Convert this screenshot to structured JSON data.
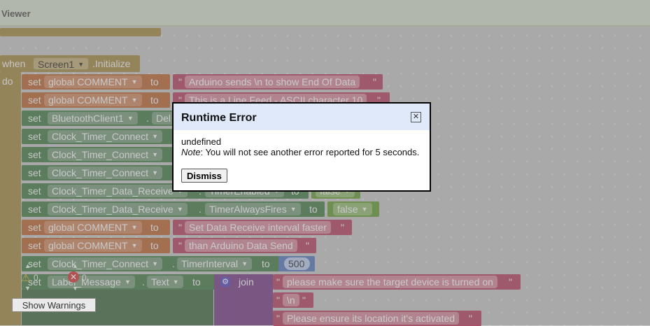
{
  "header": {
    "title": "Viewer"
  },
  "event": {
    "when": "when",
    "component": "Screen1",
    "event": ".Initialize",
    "do": "do"
  },
  "kw": {
    "set": "set",
    "to": "to",
    "global": "global",
    "join": "join"
  },
  "rows": [
    {
      "var": "global COMMENT",
      "text": "Arduino sends \\n to show End Of Data"
    },
    {
      "var": "global COMMENT",
      "text": "This is a Line Feed - ASCII character 10"
    },
    {
      "comp": "BluetoothClient1",
      "prop": "Del"
    },
    {
      "comp": "Clock_Timer_Connect"
    },
    {
      "comp": "Clock_Timer_Connect"
    },
    {
      "comp": "Clock_Timer_Connect"
    },
    {
      "comp": "Clock_Timer_Data_Receive",
      "prop": "TimerEnabled",
      "val": "false"
    },
    {
      "comp": "Clock_Timer_Data_Receive",
      "prop": "TimerAlwaysFires",
      "val": "false"
    },
    {
      "var": "global COMMENT",
      "text": "Set Data Receive interval faster"
    },
    {
      "var": "global COMMENT",
      "text": "than Arduino Data Send"
    },
    {
      "comp": "Clock_Timer_Connect",
      "prop": "TimerInterval",
      "num": "500"
    },
    {
      "comp": "Label_Message",
      "prop": "Text"
    }
  ],
  "join_strings": [
    "please make sure the target device is turned on",
    "\\n",
    "Please ensure its location it's activated"
  ],
  "error_counts": {
    "warnings": "0",
    "errors": "0"
  },
  "modal": {
    "title": "Runtime Error",
    "message": "undefined",
    "note_label": "Note",
    "note_text": ": You will not see another error reported for 5 seconds.",
    "dismiss": "Dismiss"
  },
  "warnings_button": "Show Warnings",
  "colors": {
    "event": "#a38a4a",
    "variable": "#ba6b3d",
    "component": "#4d7e50",
    "text": "#b34a66",
    "logic": "#6a9a3e",
    "math": "#5b7ab8"
  }
}
